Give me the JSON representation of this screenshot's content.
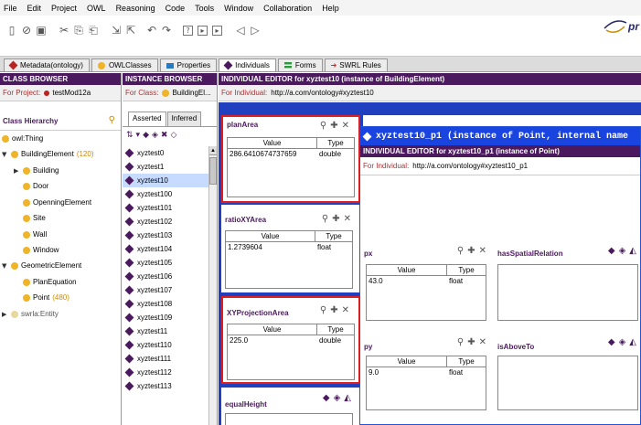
{
  "menu": [
    "File",
    "Edit",
    "Project",
    "OWL",
    "Reasoning",
    "Code",
    "Tools",
    "Window",
    "Collaboration",
    "Help"
  ],
  "logo_text": "pr",
  "tabs": [
    "Metadata(ontology)",
    "OWLClasses",
    "Properties",
    "Individuals",
    "Forms",
    "SWRL Rules"
  ],
  "class_browser": {
    "header": "CLASS BROWSER",
    "for_project_label": "For Project:",
    "project_name": "testMod12a",
    "hierarchy_label": "Class Hierarchy",
    "tree": [
      {
        "label": "owl:Thing"
      },
      {
        "label": "BuildingElement",
        "count": "(120)"
      },
      {
        "label": "Building"
      },
      {
        "label": "Door"
      },
      {
        "label": "OpenningElement"
      },
      {
        "label": "Site"
      },
      {
        "label": "Wall"
      },
      {
        "label": "Window"
      },
      {
        "label": "GeometricElement"
      },
      {
        "label": "PlanEquation"
      },
      {
        "label": "Point",
        "count": "(480)"
      },
      {
        "label": "swrla:Entity"
      }
    ]
  },
  "instance_browser": {
    "header": "INSTANCE BROWSER",
    "for_class_label": "For Class:",
    "class_name": "BuildingEl...",
    "tab_asserted": "Asserted",
    "tab_inferred": "Inferred",
    "items": [
      "xyztest0",
      "xyztest1",
      "xyztest10",
      "xyztest100",
      "xyztest101",
      "xyztest102",
      "xyztest103",
      "xyztest104",
      "xyztest105",
      "xyztest106",
      "xyztest107",
      "xyztest108",
      "xyztest109",
      "xyztest11",
      "xyztest110",
      "xyztest111",
      "xyztest112",
      "xyztest113"
    ],
    "selected_index": 2
  },
  "individual_editor": {
    "header": "INDIVIDUAL EDITOR for xyztest10  (instance of BuildingElement)",
    "for_individual_label": "For Individual:",
    "individual_uri": "http://a.com/ontology#xyztest10",
    "col_value": "Value",
    "col_type": "Type",
    "props": [
      {
        "name": "planArea",
        "value": "286.6410674737659",
        "type": "double"
      },
      {
        "name": "ratioXYArea",
        "value": "1.2739604",
        "type": "float"
      },
      {
        "name": "XYProjectionArea",
        "value": "225.0",
        "type": "double"
      },
      {
        "name": "equalHeight"
      }
    ]
  },
  "popup": {
    "title": "xyztest10_p1    (instance of Point, internal name",
    "header": "INDIVIDUAL EDITOR for xyztest10_p1  (instance of Point)",
    "for_individual_label": "For Individual:",
    "individual_uri": "http://a.com/ontology#xyztest10_p1",
    "col_value": "Value",
    "col_type": "Type",
    "px": {
      "name": "px",
      "value": "43.0",
      "type": "float"
    },
    "py": {
      "name": "py",
      "value": "9.0",
      "type": "float"
    },
    "rel1": "hasSpatialRelation",
    "rel2": "isAboveTo"
  },
  "colors": {
    "accent": "#4b1a5e",
    "highlight": "#e02020",
    "popup_border": "#2255dd",
    "class_dot": "#f0b429"
  }
}
